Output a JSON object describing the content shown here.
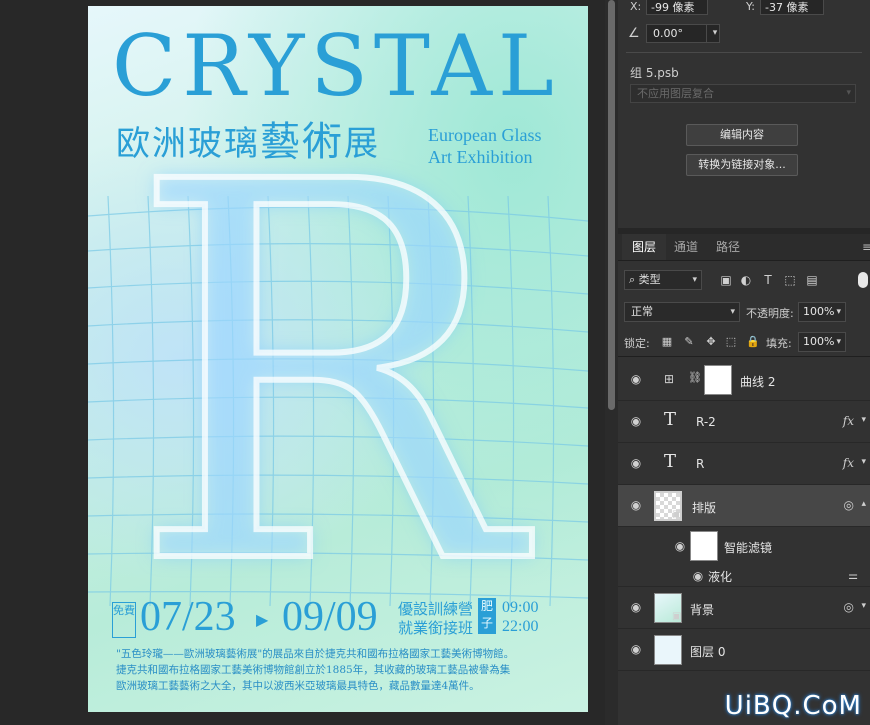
{
  "poster": {
    "title": "CRYSTAL",
    "cn_title_a": "欧洲玻璃",
    "cn_title_b": "藝術",
    "cn_title_c": "展",
    "en_line1": "European Glass",
    "en_line2": "Art Exhibition",
    "big_letter": "R",
    "date_tag": "免費",
    "date_start": "07/23",
    "date_arrow": "▶",
    "date_end": "09/09",
    "camp_line1": "優設訓練營",
    "camp_line2": "就業銜接班",
    "noon_tag": "肥子",
    "time_start": "09:00",
    "time_end": "22:00",
    "desc_line1": "\"五色玲瓏——歐洲玻璃藝術展\"的展品來自於捷克共和國布拉格國家工藝美術博物館。",
    "desc_line2": "捷克共和國布拉格國家工藝美術博物館創立於1885年，其收藏的玻璃工藝品被譽為集",
    "desc_line3": "歐洲玻璃工藝藝術之大全，其中以波西米亞玻璃最具特色，藏品數量達4萬件。"
  },
  "properties": {
    "x_label": "X:",
    "x_value": "-99 像素",
    "y_label": "Y:",
    "y_value": "-37 像素",
    "angle_value": "0.00°",
    "group_name": "组 5.psb",
    "comp_placeholder": "不应用图层复合",
    "edit_button": "编辑内容",
    "convert_button": "转换为链接对象..."
  },
  "layers_panel": {
    "tabs": [
      "图层",
      "通道",
      "路径"
    ],
    "filter_label": "类型",
    "blend_mode": "正常",
    "opacity_label": "不透明度:",
    "opacity_value": "100%",
    "lock_label": "锁定:",
    "fill_label": "填充:",
    "fill_value": "100%",
    "layers": [
      {
        "name": "曲线 2",
        "kind": "adjustment"
      },
      {
        "name": "R-2",
        "kind": "text",
        "fx": "fx"
      },
      {
        "name": "R",
        "kind": "text",
        "fx": "fx"
      },
      {
        "name": "排版",
        "kind": "smart",
        "selected": true
      },
      {
        "name": "智能滤镜",
        "kind": "smart-filters"
      },
      {
        "name": "液化",
        "kind": "filter"
      },
      {
        "name": "背景",
        "kind": "smart"
      },
      {
        "name": "图层 0",
        "kind": "pixel"
      }
    ]
  },
  "watermark": "UiBQ.CoM",
  "colors": {
    "accent": "#2a9fd6",
    "panel_bg": "#323232",
    "canvas_bg": "#282828"
  }
}
